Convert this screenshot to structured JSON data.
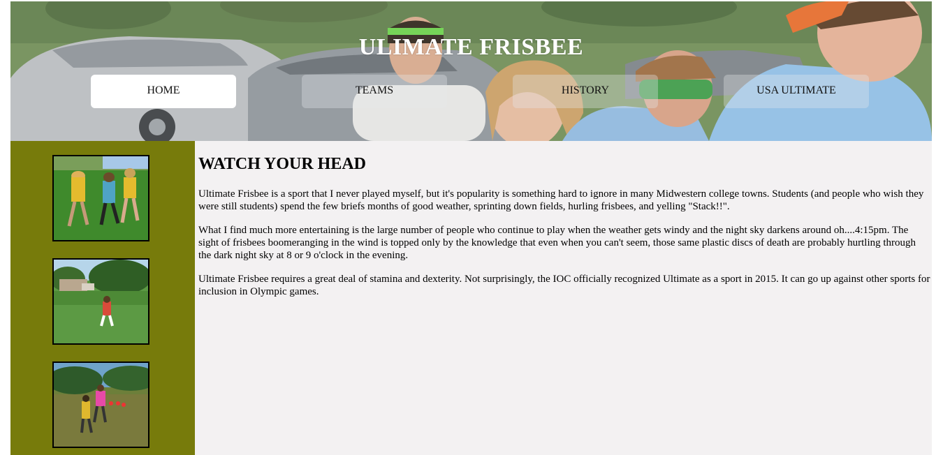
{
  "header": {
    "title": "ULIMATE FRISBEE"
  },
  "nav": {
    "items": [
      {
        "label": "HOME",
        "active": true
      },
      {
        "label": "TEAMS",
        "active": false
      },
      {
        "label": "HISTORY",
        "active": false
      },
      {
        "label": "USA ULTIMATE",
        "active": false
      }
    ]
  },
  "sidebar": {
    "background": "#777b0b",
    "images": [
      {
        "name": "frisbee-photo-1"
      },
      {
        "name": "frisbee-photo-2"
      },
      {
        "name": "frisbee-photo-3"
      }
    ]
  },
  "main": {
    "heading": "WATCH YOUR HEAD",
    "paragraphs": [
      "Ultimate Frisbee is a sport that I never played myself, but it's popularity is something hard to ignore in many Midwestern college towns. Students (and people who wish they were still students) spend the few briefs months of good weather, sprinting down fields, hurling frisbees, and yelling \"Stack!!\".",
      "What I find much more entertaining is the large number of people who continue to play when the weather gets windy and the night sky darkens around oh....4:15pm. The sight of frisbees boomeranging in the wind is topped only by the knowledge that even when you can't seem, those same plastic discs of death are probably hurtling through the dark night sky at 8 or 9 o'clock in the evening.",
      "Ultimate Frisbee requires a great deal of stamina and dexterity. Not surprisingly, the IOC officially recognized Ultimate as a sport in 2015. It can go up against other sports for inclusion in Olympic games."
    ]
  },
  "colors": {
    "page_background": "#f3f1f2",
    "sidebar": "#777b0b",
    "nav_active": "#ffffff",
    "title": "#ffffff"
  }
}
